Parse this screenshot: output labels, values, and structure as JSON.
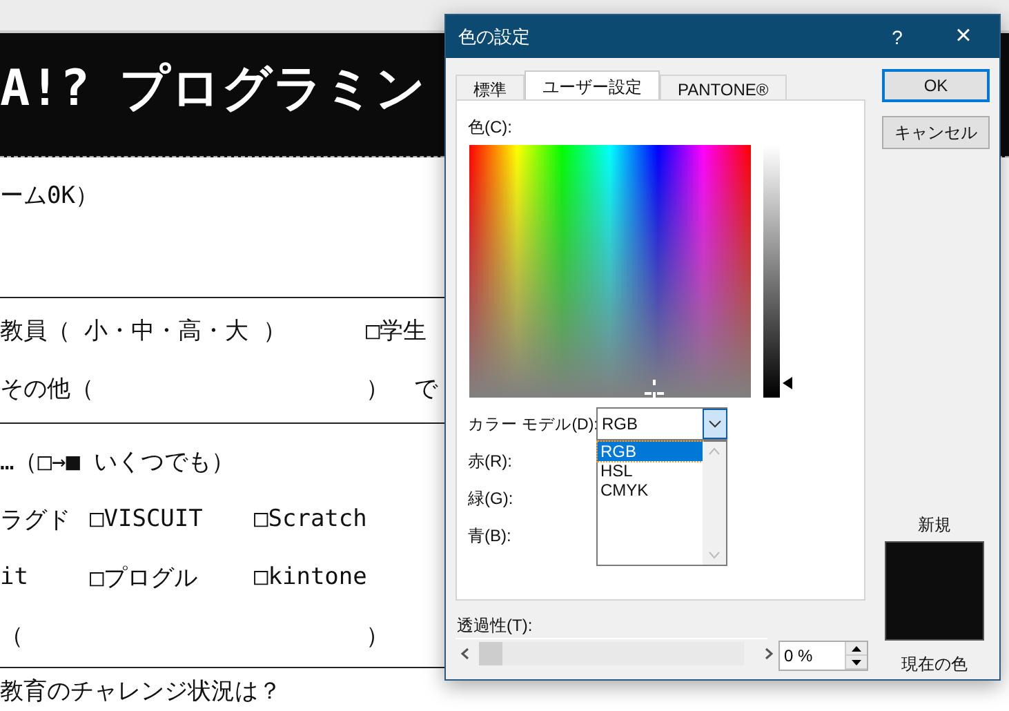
{
  "document": {
    "banner": "A!? プログラミン",
    "sections": [
      [
        {
          "kind": "single",
          "cells": [
            "ーム0K）"
          ]
        }
      ],
      [
        {
          "kind": "pair",
          "cells": [
            "教員（ 小・中・高・大 ）",
            "□学生"
          ]
        },
        {
          "kind": "pair_tail",
          "cells": [
            "その他（",
            "）",
            "で"
          ]
        }
      ],
      [
        {
          "kind": "single",
          "cells": [
            "…（□→■ いくつでも）"
          ]
        },
        {
          "kind": "options",
          "cells": [
            "ラグド",
            "□VISCUIT",
            "□Scratch"
          ]
        },
        {
          "kind": "options",
          "cells": [
            "it",
            "□プログル",
            "□kintone"
          ]
        },
        {
          "kind": "pair",
          "cells": [
            "（",
            "）"
          ]
        }
      ],
      [
        {
          "kind": "single",
          "cells": [
            "教育のチャレンジ状況は？"
          ]
        }
      ]
    ]
  },
  "dialog": {
    "title": "色の設定",
    "help": "?",
    "close": "×",
    "tabs": [
      {
        "label": "標準",
        "selected": false
      },
      {
        "label": "ユーザー設定",
        "selected": true
      },
      {
        "label": "PANTONE®",
        "selected": false
      }
    ],
    "color_label": "色(C):",
    "color_model": {
      "label": "カラー モデル(D):",
      "value": "RGB",
      "expanded": true,
      "options": [
        {
          "label": "RGB",
          "selected": true
        },
        {
          "label": "HSL",
          "selected": false
        },
        {
          "label": "CMYK",
          "selected": false
        }
      ]
    },
    "channels": [
      {
        "label": "赤(R):"
      },
      {
        "label": "緑(G):"
      },
      {
        "label": "青(B):"
      }
    ],
    "transparency": {
      "label": "透過性(T):",
      "value": "0 %",
      "level": 0
    },
    "buttons": [
      {
        "label": "OK",
        "default": true
      },
      {
        "label": "キャンセル",
        "default": false
      }
    ],
    "new_label": "新規",
    "current_label": "現在の色"
  }
}
